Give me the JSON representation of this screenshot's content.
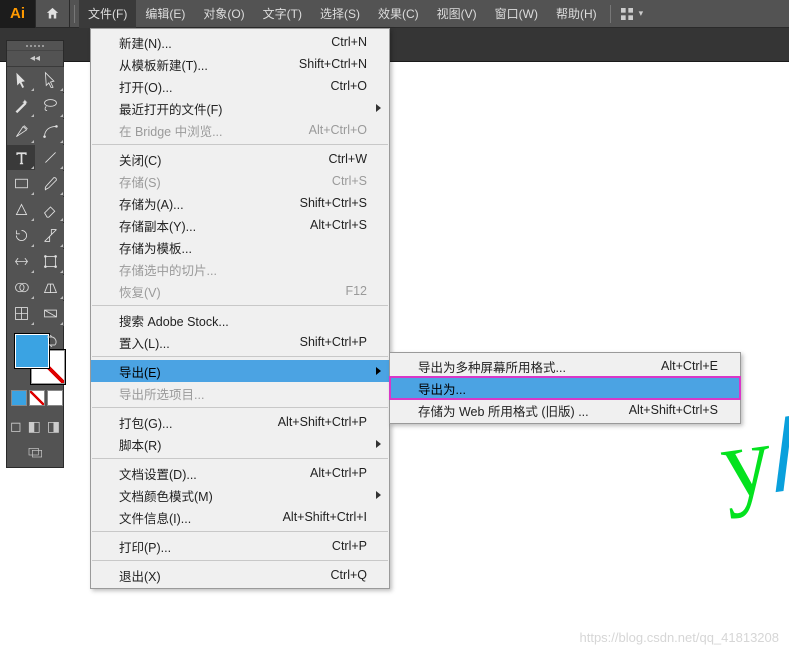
{
  "app": {
    "logo_text": "Ai"
  },
  "menubar": {
    "items": [
      "文件(F)",
      "编辑(E)",
      "对象(O)",
      "文字(T)",
      "选择(S)",
      "效果(C)",
      "视图(V)",
      "窗口(W)",
      "帮助(H)"
    ],
    "active_index": 0
  },
  "file_menu": {
    "groups": [
      [
        {
          "label": "新建(N)...",
          "shortcut": "Ctrl+N"
        },
        {
          "label": "从模板新建(T)...",
          "shortcut": "Shift+Ctrl+N"
        },
        {
          "label": "打开(O)...",
          "shortcut": "Ctrl+O"
        },
        {
          "label": "最近打开的文件(F)",
          "shortcut": "",
          "submenu": true
        },
        {
          "label": "在 Bridge 中浏览...",
          "shortcut": "Alt+Ctrl+O",
          "disabled": true
        }
      ],
      [
        {
          "label": "关闭(C)",
          "shortcut": "Ctrl+W"
        },
        {
          "label": "存储(S)",
          "shortcut": "Ctrl+S",
          "disabled": true
        },
        {
          "label": "存储为(A)...",
          "shortcut": "Shift+Ctrl+S"
        },
        {
          "label": "存储副本(Y)...",
          "shortcut": "Alt+Ctrl+S"
        },
        {
          "label": "存储为模板...",
          "shortcut": ""
        },
        {
          "label": "存储选中的切片...",
          "shortcut": "",
          "disabled": true
        },
        {
          "label": "恢复(V)",
          "shortcut": "F12",
          "disabled": true
        }
      ],
      [
        {
          "label": "搜索 Adobe Stock...",
          "shortcut": ""
        },
        {
          "label": "置入(L)...",
          "shortcut": "Shift+Ctrl+P"
        }
      ],
      [
        {
          "label": "导出(E)",
          "shortcut": "",
          "submenu": true,
          "highlight": true
        },
        {
          "label": "导出所选项目...",
          "shortcut": "",
          "disabled": true
        }
      ],
      [
        {
          "label": "打包(G)...",
          "shortcut": "Alt+Shift+Ctrl+P"
        },
        {
          "label": "脚本(R)",
          "shortcut": "",
          "submenu": true
        }
      ],
      [
        {
          "label": "文档设置(D)...",
          "shortcut": "Alt+Ctrl+P"
        },
        {
          "label": "文档颜色模式(M)",
          "shortcut": "",
          "submenu": true
        },
        {
          "label": "文件信息(I)...",
          "shortcut": "Alt+Shift+Ctrl+I"
        }
      ],
      [
        {
          "label": "打印(P)...",
          "shortcut": "Ctrl+P"
        }
      ],
      [
        {
          "label": "退出(X)",
          "shortcut": "Ctrl+Q"
        }
      ]
    ]
  },
  "export_submenu": {
    "items": [
      {
        "label": "导出为多种屏幕所用格式...",
        "shortcut": "Alt+Ctrl+E"
      },
      {
        "label": "导出为...",
        "shortcut": "",
        "highlight": true,
        "annotated": true
      },
      {
        "label": "存储为 Web 所用格式 (旧版) ...",
        "shortcut": "Alt+Shift+Ctrl+S"
      }
    ]
  },
  "tools": {
    "items": [
      "selection-tool",
      "direct-selection-tool",
      "magic-wand-tool",
      "lasso-tool",
      "pen-tool",
      "curvature-tool",
      "type-tool",
      "line-segment-tool",
      "rectangle-tool",
      "paintbrush-tool",
      "shaper-tool",
      "eraser-tool",
      "rotate-tool",
      "scale-tool",
      "width-tool",
      "free-transform-tool",
      "shape-builder-tool",
      "perspective-grid-tool",
      "mesh-tool",
      "gradient-tool"
    ],
    "selected_index": 6
  },
  "colors": {
    "foreground": "#3aa3e3",
    "background": "none"
  },
  "watermark": "https://blog.csdn.net/qq_41813208"
}
